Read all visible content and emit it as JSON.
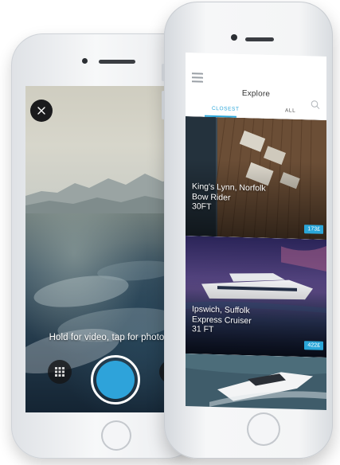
{
  "camera": {
    "hint": "Hold for video, tap for photo"
  },
  "explore": {
    "title": "Explore",
    "tabs": [
      {
        "label": "CLOSEST",
        "active": true
      },
      {
        "label": "ALL",
        "active": false
      }
    ],
    "listings": [
      {
        "location": "King's Lynn, Norfolk",
        "name": "Bow Rider",
        "length": "30FT",
        "price": "173£"
      },
      {
        "location": "Ipswich, Suffolk",
        "name": "Express Cruiser",
        "length": "31 FT",
        "price": "422£"
      },
      {
        "location": "",
        "name": "",
        "length": "",
        "price": ""
      }
    ]
  },
  "colors": {
    "accent": "#2aa6d9",
    "shutter": "#2ea3da"
  },
  "icons": [
    "close-icon",
    "gallery-icon",
    "menu-icon",
    "search-icon"
  ]
}
